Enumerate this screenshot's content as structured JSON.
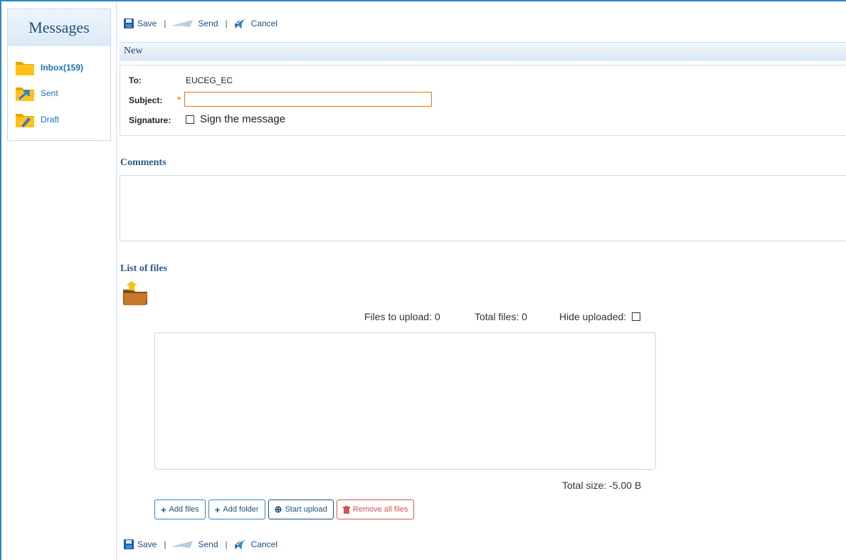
{
  "sidebar": {
    "title": "Messages",
    "items": [
      {
        "label": "Inbox(159)",
        "icon": "inbox-folder-icon"
      },
      {
        "label": "Sent",
        "icon": "sent-folder-icon"
      },
      {
        "label": "Draft",
        "icon": "draft-folder-icon"
      }
    ]
  },
  "toolbar": {
    "save_label": "Save",
    "send_label": "Send",
    "cancel_label": "Cancel",
    "separator": "|"
  },
  "form": {
    "header": "New",
    "to_label": "To:",
    "to_value": "EUCEG_EC",
    "subject_label": "Subject:",
    "subject_value": "",
    "required_mark": "*",
    "signature_label": "Signature:",
    "signature_option": "Sign the message"
  },
  "comments": {
    "title": "Comments",
    "value": ""
  },
  "files": {
    "title": "List of files",
    "files_to_upload": "Files to upload: 0",
    "total_files": "Total files: 0",
    "hide_uploaded": "Hide uploaded:",
    "total_size": "Total size:  -5.00 B",
    "buttons": {
      "add_files": "Add files",
      "add_folder": "Add folder",
      "start_upload": "Start upload",
      "remove_all": "Remove all files"
    }
  },
  "colors": {
    "accent": "#2f86c3",
    "link": "#1b6fb5",
    "required": "#e06a1a",
    "danger": "#d9534f"
  }
}
